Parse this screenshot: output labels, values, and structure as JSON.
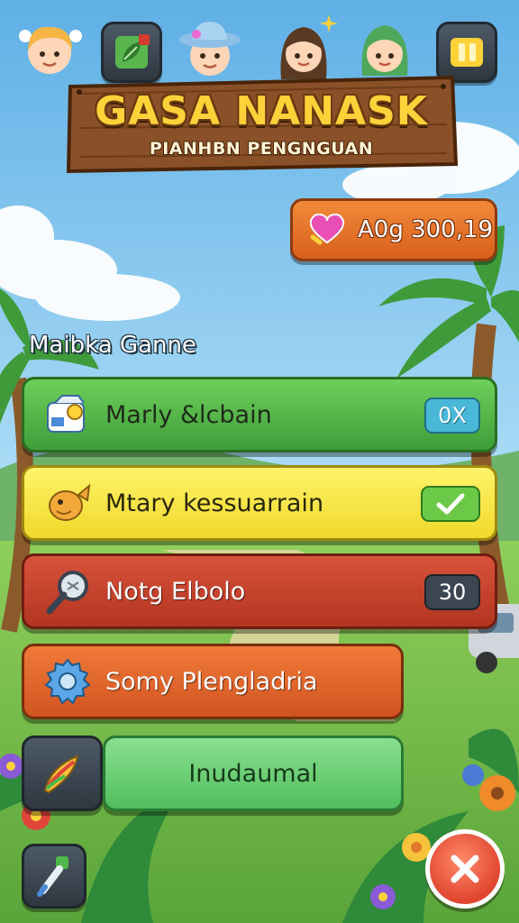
{
  "title": {
    "main": "GASA NANASK",
    "subtitle": "PIANHBN PENGNGUAN"
  },
  "top_bar": {
    "avatars": [
      "girl-blonde-avatar",
      "boy-hat-avatar",
      "girl-brown-hair-avatar",
      "girl-green-hair-avatar"
    ],
    "left_icon": "leaf-card-icon",
    "right_icon": "pause-icon"
  },
  "currency": {
    "icon": "heart-icon",
    "value": "A0g 300,19"
  },
  "section_label": "Maibka Ganne",
  "options": [
    {
      "label": "Marly &lcbain",
      "badge": "0X",
      "icon": "milk-carton-icon",
      "color": "#4fb84a",
      "badge_color": "#3aa6c6"
    },
    {
      "label": "Mtary kessuarrain",
      "badge": "check",
      "icon": "fish-icon",
      "color": "#f6ea3b",
      "badge_color": "#5cbf3c"
    },
    {
      "label": "Notg Elbolo",
      "badge": "30",
      "icon": "magnifier-icon",
      "color": "#c9402b",
      "badge_color": "#3b4650"
    },
    {
      "label": "Somy Plengladria",
      "badge": "",
      "icon": "gear-icon",
      "color": "#e0642b",
      "badge_color": ""
    },
    {
      "label": "Inudaumal",
      "badge": "",
      "icon": "paintbrush-icon",
      "color": "#6ed37a",
      "badge_color": ""
    }
  ],
  "buttons": {
    "close_icon": "close-icon",
    "side_icon": "brush-tool-icon"
  }
}
